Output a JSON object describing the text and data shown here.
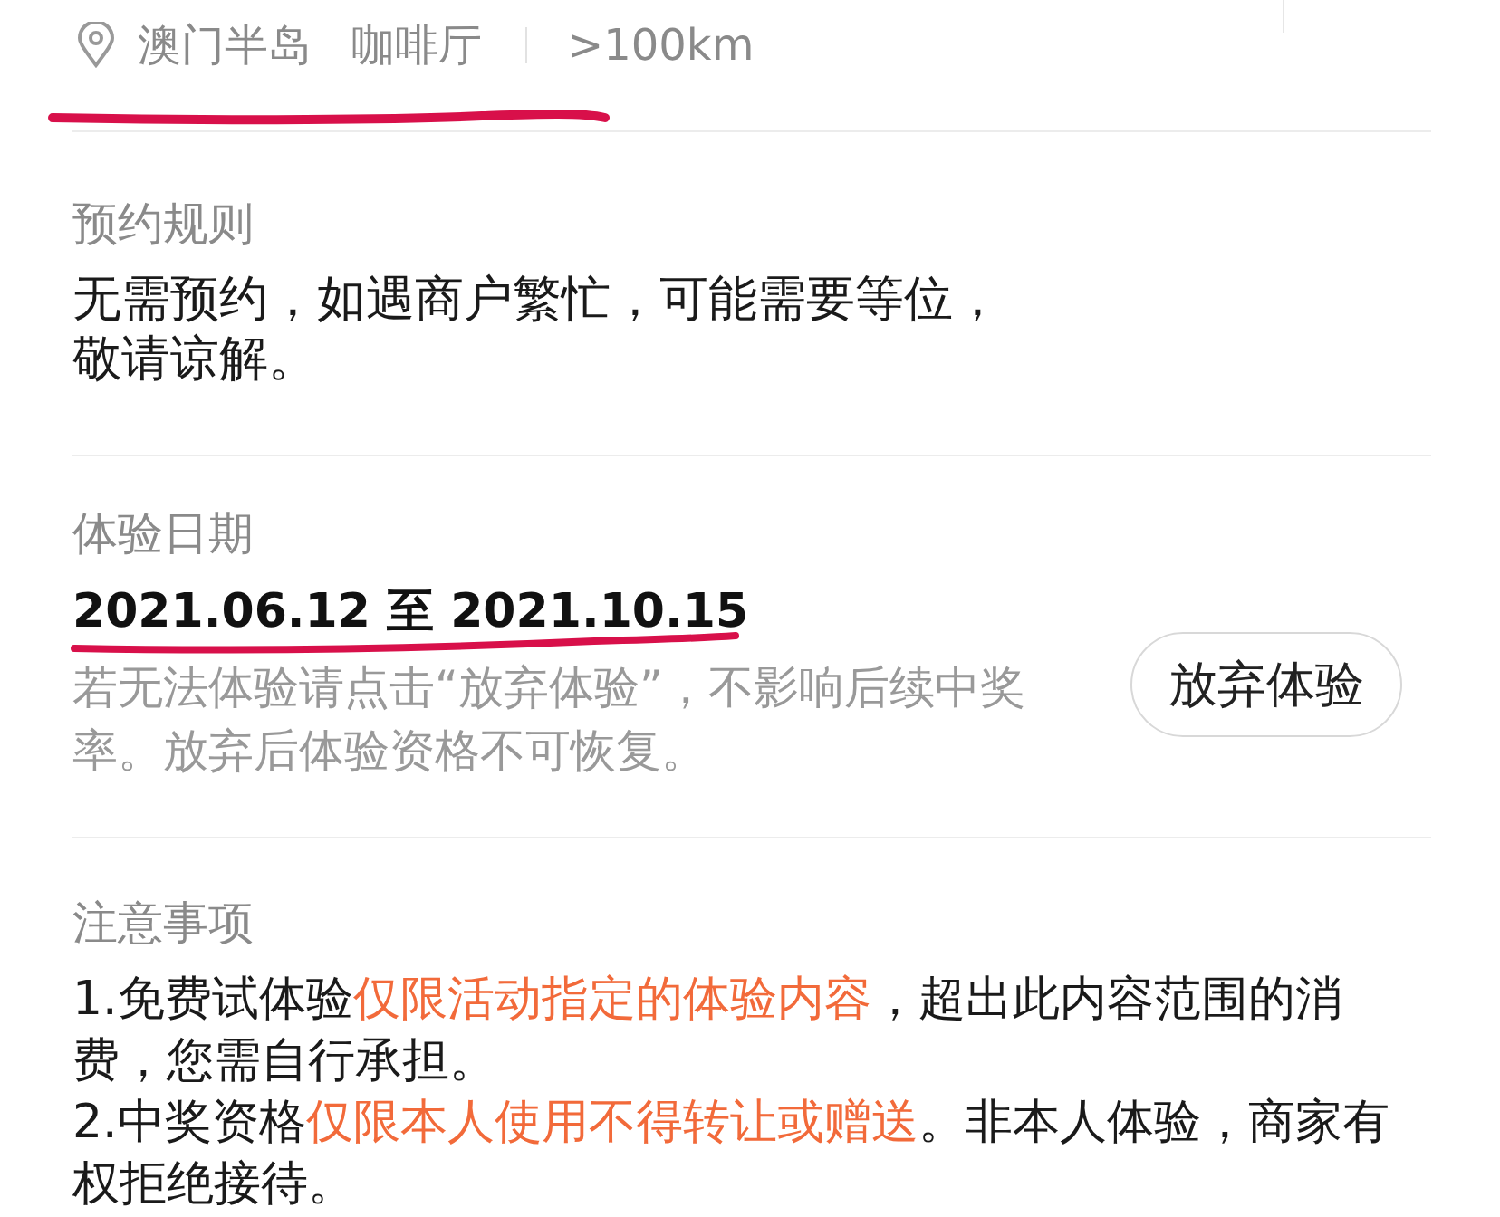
{
  "location": {
    "area": "澳门半岛",
    "category": "咖啡厅",
    "distance": ">100km"
  },
  "rules": {
    "title": "预约规则",
    "text": "无需预约，如遇商户繁忙，可能需要等位，敬请谅解。"
  },
  "dates": {
    "title": "体验日期",
    "range": "2021.06.12 至 2021.10.15",
    "hint": "若无法体验请点击“放弃体验”，不影响后续中奖率。放弃后体验资格不可恢复。",
    "button": "放弃体验"
  },
  "notes": {
    "title": "注意事项",
    "items": [
      [
        {
          "text": "1.免费试体验",
          "highlight": false
        },
        {
          "text": "仅限活动指定的体验内容",
          "highlight": true
        },
        {
          "text": "，超出此内容范围的消费，您需自行承担。",
          "highlight": false
        }
      ],
      [
        {
          "text": "2.中奖资格",
          "highlight": false
        },
        {
          "text": "仅限本人使用不得转让或赠送",
          "highlight": true
        },
        {
          "text": "。非本人体验，商家有权拒绝接待。",
          "highlight": false
        }
      ]
    ]
  }
}
